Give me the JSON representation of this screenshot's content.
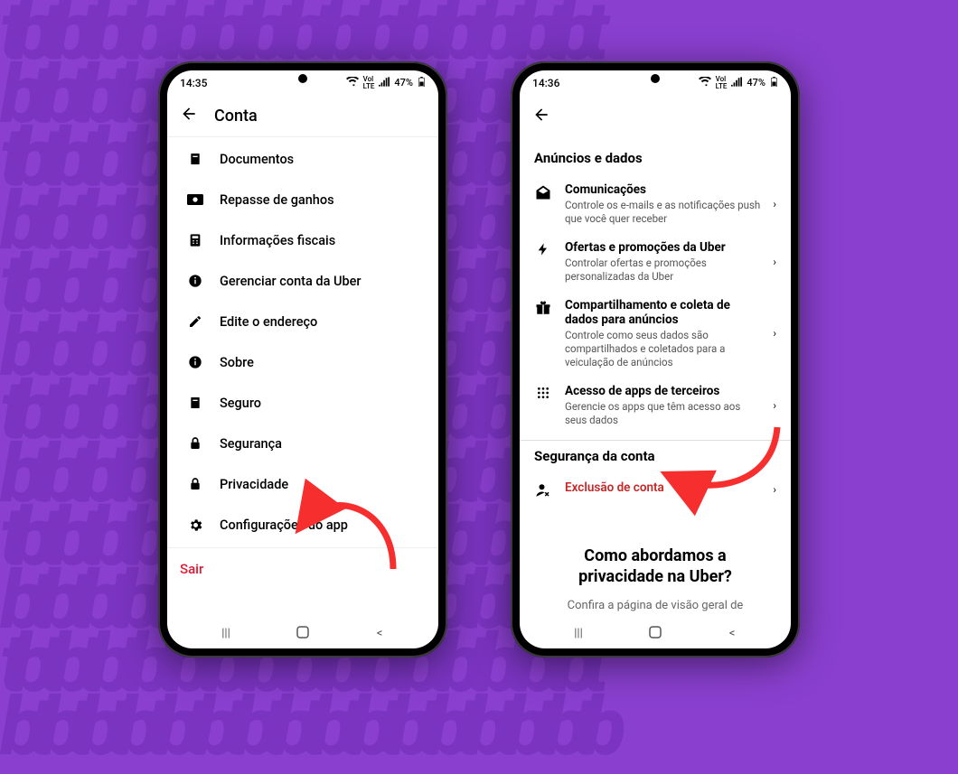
{
  "phone1": {
    "time": "14:35",
    "battery": "47%",
    "header_title": "Conta",
    "items": [
      {
        "icon": "doc-icon",
        "label": "Documentos"
      },
      {
        "icon": "money-icon",
        "label": "Repasse de ganhos"
      },
      {
        "icon": "calc-icon",
        "label": "Informações fiscais"
      },
      {
        "icon": "info-icon",
        "label": "Gerenciar conta da Uber"
      },
      {
        "icon": "pencil-icon",
        "label": "Edite o endereço"
      },
      {
        "icon": "info-icon",
        "label": "Sobre"
      },
      {
        "icon": "doc-icon",
        "label": "Seguro"
      },
      {
        "icon": "lock-icon",
        "label": "Segurança"
      },
      {
        "icon": "lock-icon",
        "label": "Privacidade"
      },
      {
        "icon": "gear-icon",
        "label": "Configurações do app"
      }
    ],
    "logout_label": "Sair"
  },
  "phone2": {
    "time": "14:36",
    "battery": "47%",
    "section1_title": "Anúncios e dados",
    "rows": [
      {
        "icon": "mail-open-icon",
        "title": "Comunicações",
        "sub": "Controle os e-mails e as notificações push que você quer receber"
      },
      {
        "icon": "bolt-icon",
        "title": "Ofertas e promoções da Uber",
        "sub": "Controlar ofertas e promoções personalizadas da Uber"
      },
      {
        "icon": "gift-icon",
        "title": "Compartilhamento e coleta de dados para anúncios",
        "sub": "Controle como seus dados são compartilhados e coletados para a veiculação de anúncios"
      },
      {
        "icon": "apps-icon",
        "title": "Acesso de apps de terceiros",
        "sub": "Gerencie os apps que têm acesso aos seus dados"
      }
    ],
    "section2_title": "Segurança da conta",
    "delete_row_title": "Exclusão de conta",
    "big_text_line1": "Como abordamos a",
    "big_text_line2": "privacidade na Uber?",
    "footer_text": "Confira a página de visão geral de"
  },
  "colors": {
    "accent_red": "#e11931",
    "delete_red": "#c62828",
    "arrow_red": "#f72e2e",
    "bg_purple": "#8a3fcf"
  }
}
